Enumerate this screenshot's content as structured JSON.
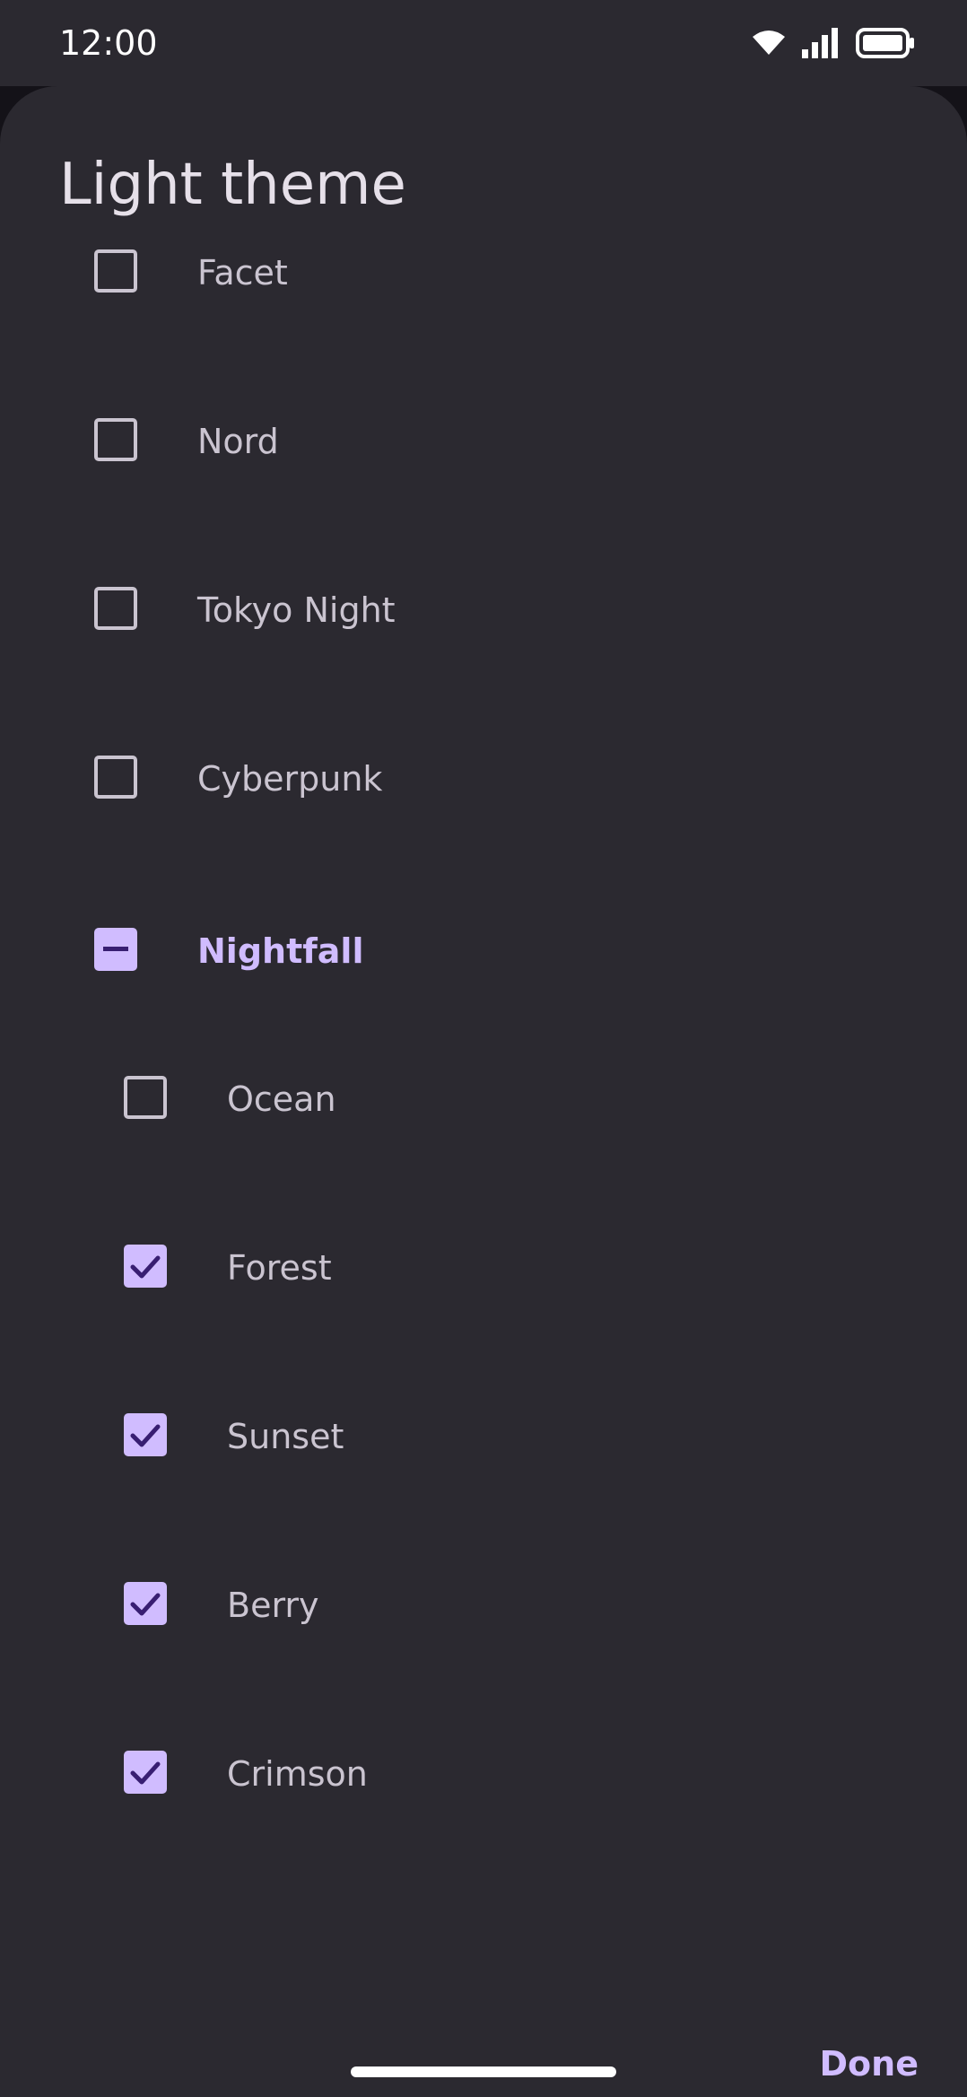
{
  "status_bar": {
    "time": "12:00",
    "icons": [
      "wifi-icon",
      "signal-icon",
      "battery-icon"
    ]
  },
  "dialog": {
    "title": "Light theme",
    "done_label": "Done"
  },
  "options": [
    {
      "label": "Facet",
      "state": "unchecked",
      "level": 0
    },
    {
      "label": "Nord",
      "state": "unchecked",
      "level": 0
    },
    {
      "label": "Tokyo Night",
      "state": "unchecked",
      "level": 0
    },
    {
      "label": "Cyberpunk",
      "state": "unchecked",
      "level": 0
    },
    {
      "label": "Nightfall",
      "state": "indeterminate",
      "level": 0
    },
    {
      "label": "Ocean",
      "state": "unchecked",
      "level": 1
    },
    {
      "label": "Forest",
      "state": "checked",
      "level": 1
    },
    {
      "label": "Sunset",
      "state": "checked",
      "level": 1
    },
    {
      "label": "Berry",
      "state": "checked",
      "level": 1
    },
    {
      "label": "Crimson",
      "state": "checked",
      "level": 1
    }
  ],
  "colors": {
    "background": "#2B2930",
    "scrim": "#141218",
    "accent": "#D0BCFF",
    "on_accent": "#381E72",
    "text_primary": "#E6E0E9",
    "text_secondary": "#CAC4D0"
  }
}
